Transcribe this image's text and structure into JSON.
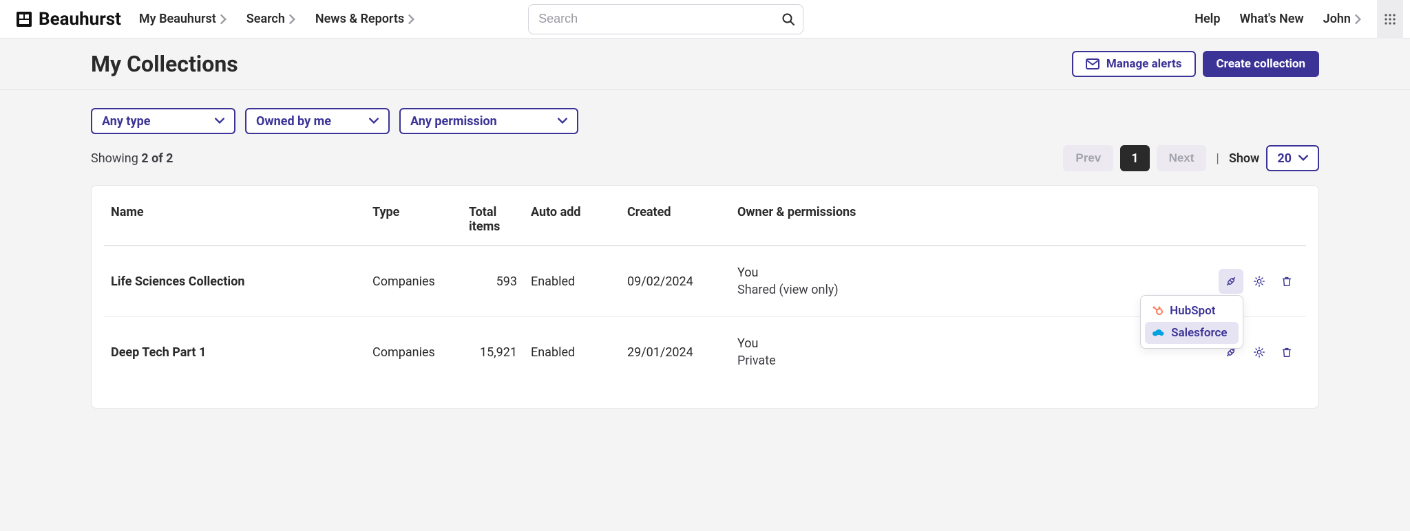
{
  "brand": "Beauhurst",
  "nav": {
    "my": "My Beauhurst",
    "search": "Search",
    "news": "News & Reports"
  },
  "search": {
    "placeholder": "Search"
  },
  "right_nav": {
    "help": "Help",
    "whats_new": "What's New",
    "user": "John"
  },
  "page": {
    "title": "My Collections",
    "manage_alerts": "Manage alerts",
    "create": "Create collection"
  },
  "filters": {
    "type": "Any type",
    "owned": "Owned by me",
    "perm": "Any permission"
  },
  "showing": {
    "prefix": "Showing ",
    "bold": "2 of 2"
  },
  "pager": {
    "prev": "Prev",
    "current": "1",
    "next": "Next",
    "show_label": "Show",
    "show_value": "20"
  },
  "columns": {
    "name": "Name",
    "type": "Type",
    "total": "Total items",
    "auto": "Auto add",
    "created": "Created",
    "owner": "Owner & permissions"
  },
  "rows": [
    {
      "name": "Life Sciences Collection",
      "type": "Companies",
      "total": "593",
      "auto": "Enabled",
      "created": "09/02/2024",
      "owner_line1": "You",
      "owner_line2": "Shared (view only)"
    },
    {
      "name": "Deep Tech Part 1",
      "type": "Companies",
      "total": "15,921",
      "auto": "Enabled",
      "created": "29/01/2024",
      "owner_line1": "You",
      "owner_line2": "Private"
    }
  ],
  "popover": {
    "hubspot": "HubSpot",
    "salesforce": "Salesforce"
  }
}
